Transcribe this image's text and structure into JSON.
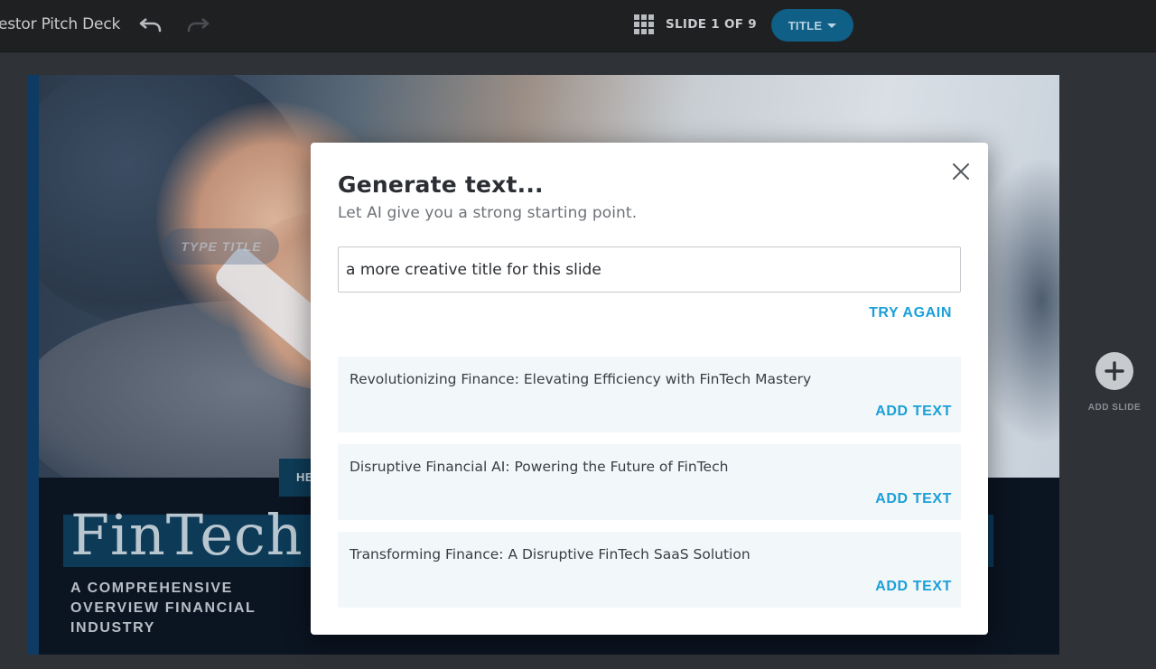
{
  "topbar": {
    "doc_title": "estor Pitch Deck",
    "slide_counter": "SLIDE 1 OF 9",
    "layout_button": "TITLE"
  },
  "slide": {
    "placeholder": "TYPE TITLE",
    "tag": "HE",
    "headline": "FinTech",
    "subtitle": "A COMPREHENSIVE OVERVIEW FINANCIAL INDUSTRY"
  },
  "sidebar": {
    "add_slide_label": "ADD SLIDE"
  },
  "modal": {
    "title": "Generate text...",
    "subtitle": "Let AI give you a strong starting point.",
    "prompt_value": "a more creative title for this slide",
    "try_again_label": "TRY AGAIN",
    "suggestions": [
      {
        "text": "Revolutionizing Finance: Elevating Efficiency with FinTech Mastery",
        "action": "ADD TEXT"
      },
      {
        "text": "Disruptive Financial AI: Powering the Future of FinTech",
        "action": "ADD TEXT"
      },
      {
        "text": "Transforming Finance: A Disruptive FinTech SaaS Solution",
        "action": "ADD TEXT"
      }
    ]
  },
  "colors": {
    "accent": "#1aa0d8",
    "topbar_bg": "#1f2022",
    "layout_button_bg": "#0f5f86",
    "slide_bg": "#0b1421"
  },
  "icons": {
    "undo": "undo-icon",
    "redo": "redo-icon",
    "grid": "grid-icon",
    "caret": "caret-down-icon",
    "add": "plus-icon",
    "close": "close-icon"
  }
}
